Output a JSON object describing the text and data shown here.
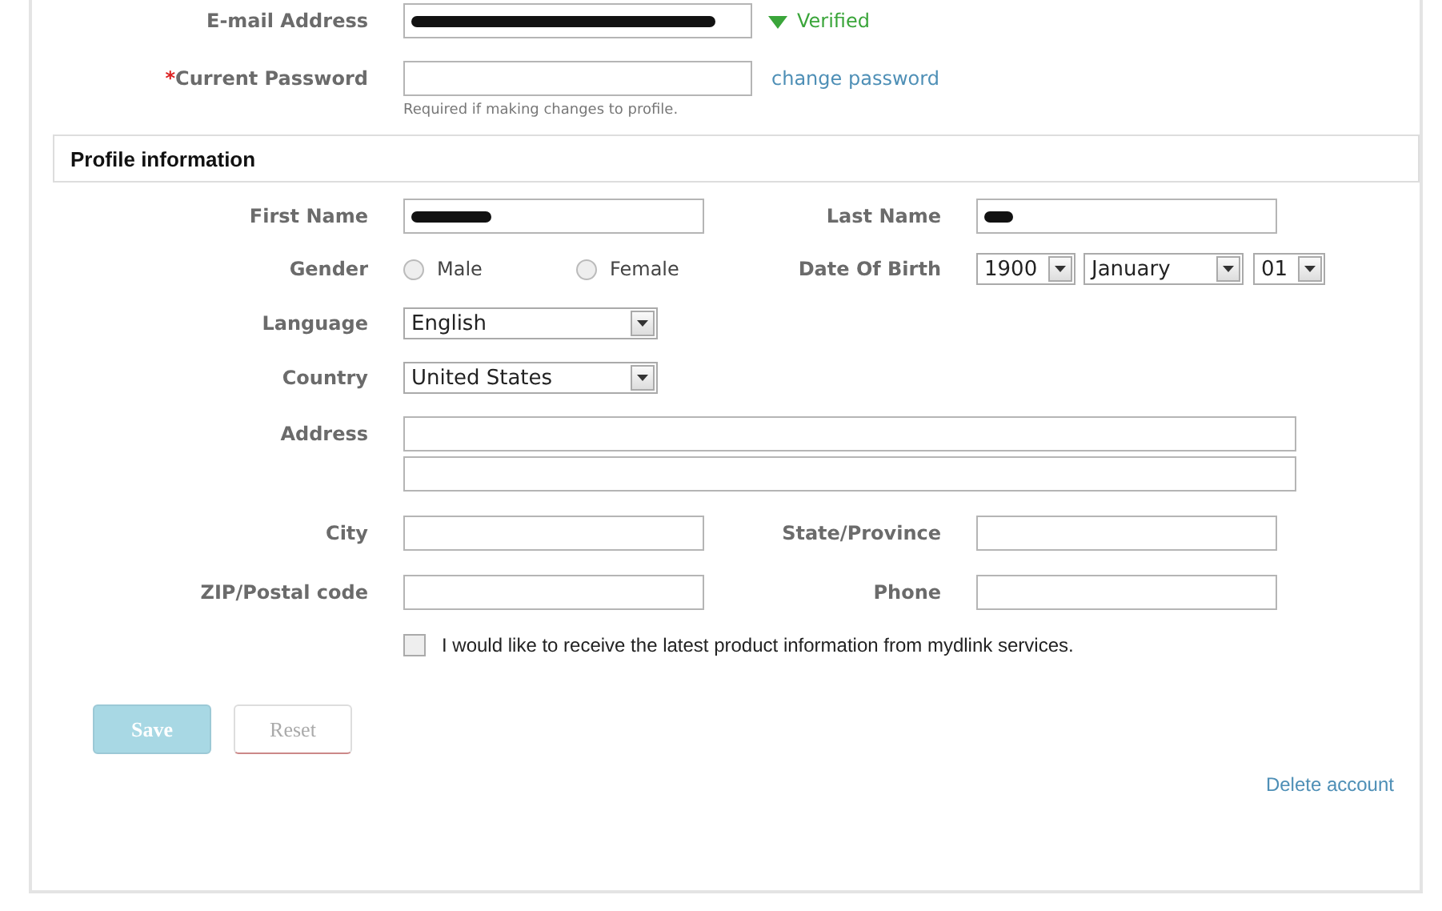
{
  "account": {
    "email": {
      "label": "E-mail Address",
      "status": "Verified"
    },
    "password": {
      "required_mark": "*",
      "label": "Current Password",
      "link": "change password",
      "hint": "Required if making changes to profile."
    }
  },
  "profile": {
    "title": "Profile information",
    "first_name": {
      "label": "First Name"
    },
    "last_name": {
      "label": "Last Name"
    },
    "gender": {
      "label": "Gender",
      "options": [
        {
          "label": "Male",
          "selected": false
        },
        {
          "label": "Female",
          "selected": false
        }
      ]
    },
    "date_of_birth": {
      "label": "Date Of Birth",
      "year": "1900",
      "month": "January",
      "day": "01"
    },
    "language": {
      "label": "Language",
      "value": "English"
    },
    "country": {
      "label": "Country",
      "value": "United States"
    },
    "address": {
      "label": "Address"
    },
    "city": {
      "label": "City"
    },
    "state": {
      "label": "State/Province"
    },
    "zip": {
      "label": "ZIP/Postal code"
    },
    "phone": {
      "label": "Phone"
    },
    "newsletter": {
      "label": "I would like to receive the latest product information from mydlink services.",
      "checked": false
    }
  },
  "buttons": [
    {
      "label": "Save",
      "kind": "primary"
    },
    {
      "label": "Reset",
      "kind": "secondary"
    }
  ],
  "delete_link": "Delete account"
}
